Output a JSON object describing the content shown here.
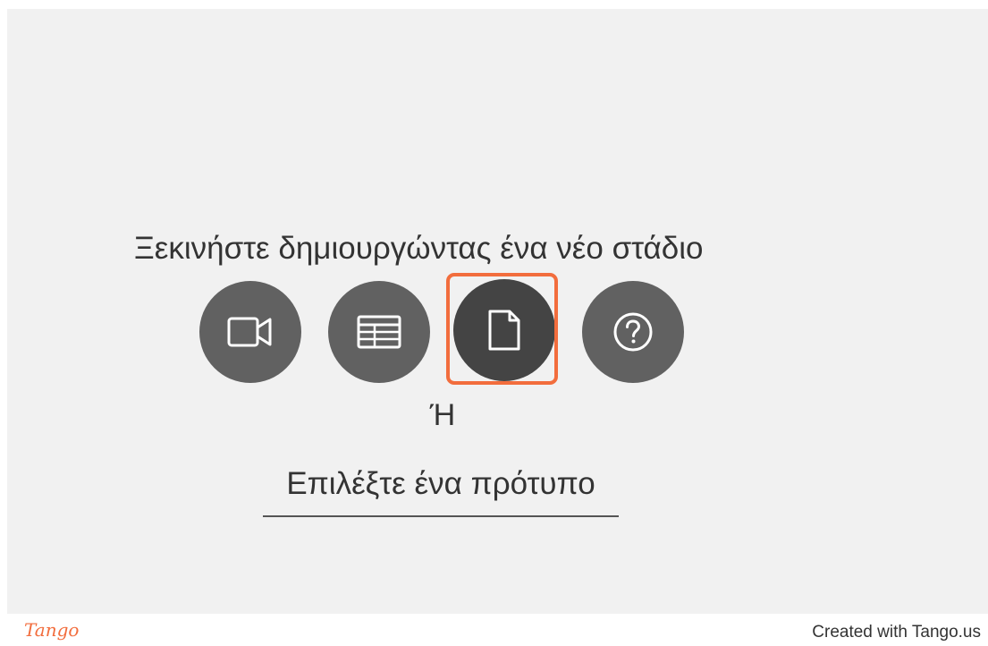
{
  "prompt": {
    "headline": "Ξεκινήστε δημιουργώντας ένα νέο στάδιο"
  },
  "stage_types": [
    {
      "icon": "video-camera-icon",
      "active": false
    },
    {
      "icon": "table-icon",
      "active": false
    },
    {
      "icon": "document-icon",
      "active": true
    },
    {
      "icon": "question-mark-icon",
      "active": false
    }
  ],
  "separator": {
    "or_text": "Ή"
  },
  "template": {
    "link_label": "Επιλέξτε ένα πρότυπο"
  },
  "footer": {
    "logo_text": "Tango",
    "credit_text": "Created with Tango.us"
  },
  "colors": {
    "highlight": "#f26d3d",
    "button": "#616161",
    "button_active": "#444444",
    "panel_bg": "#f1f1f1"
  }
}
